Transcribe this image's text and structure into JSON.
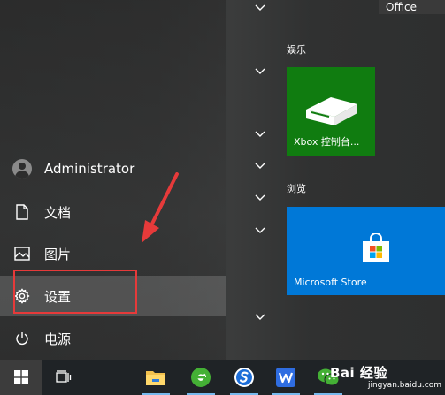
{
  "user": {
    "name": "Administrator"
  },
  "menu": {
    "documents": "文档",
    "pictures": "图片",
    "settings": "设置",
    "power": "电源"
  },
  "groups": {
    "office": "Office",
    "entertainment": "娱乐",
    "browse": "浏览"
  },
  "tiles": {
    "xbox": "Xbox 控制台...",
    "store": "Microsoft Store"
  },
  "watermark": {
    "main": "Bai 经验",
    "sub": "jingyan.baidu.com"
  },
  "colors": {
    "xbox_tile": "#107c10",
    "store_tile": "#0078d7",
    "highlight": "#e63a3a",
    "taskbar": "#1f2326"
  }
}
